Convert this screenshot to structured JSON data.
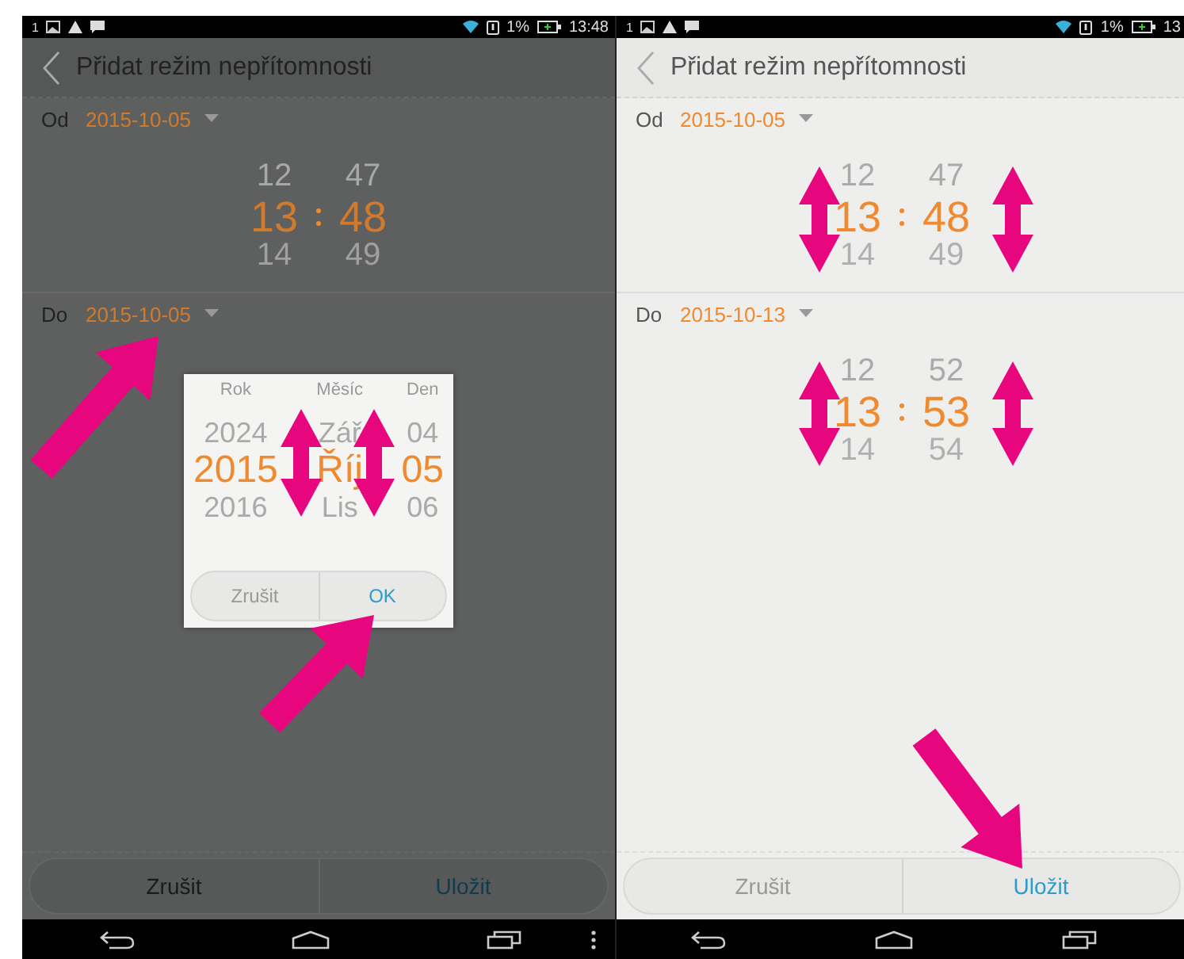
{
  "screens": [
    {
      "dimmed": true,
      "status_bar": {
        "notification_count": "1",
        "battery": "1%",
        "time": "13:48"
      },
      "title": "Přidat režim nepřítomnosti",
      "from": {
        "label": "Od",
        "date": "2015-10-05",
        "time": {
          "hours": [
            "12",
            "13",
            "14"
          ],
          "minutes": [
            "47",
            "48",
            "49"
          ]
        }
      },
      "to": {
        "label": "Do",
        "date": "2015-10-05"
      },
      "dialog": {
        "columns": [
          {
            "label": "Rok",
            "values": [
              "2024",
              "2015",
              "2016"
            ]
          },
          {
            "label": "Měsíc",
            "values": [
              "Zář",
              "Říj",
              "Lis"
            ]
          },
          {
            "label": "Den",
            "values": [
              "04",
              "05",
              "06"
            ]
          }
        ],
        "buttons": [
          {
            "label": "Zrušit",
            "primary": false
          },
          {
            "label": "OK",
            "primary": true
          }
        ]
      },
      "buttons": [
        {
          "label": "Zrušit",
          "primary": false
        },
        {
          "label": "Uložit",
          "primary": true
        }
      ],
      "overflow_menu": true
    },
    {
      "dimmed": false,
      "status_bar": {
        "notification_count": "1",
        "battery": "1%",
        "time": "13"
      },
      "title": "Přidat režim nepřítomnosti",
      "from": {
        "label": "Od",
        "date": "2015-10-05",
        "time": {
          "hours": [
            "12",
            "13",
            "14"
          ],
          "minutes": [
            "47",
            "48",
            "49"
          ]
        }
      },
      "to": {
        "label": "Do",
        "date": "2015-10-13",
        "time": {
          "hours": [
            "12",
            "13",
            "14"
          ],
          "minutes": [
            "52",
            "53",
            "54"
          ]
        }
      },
      "buttons": [
        {
          "label": "Zrušit",
          "primary": false
        },
        {
          "label": "Uložit",
          "primary": true
        }
      ],
      "overflow_menu": false
    }
  ]
}
